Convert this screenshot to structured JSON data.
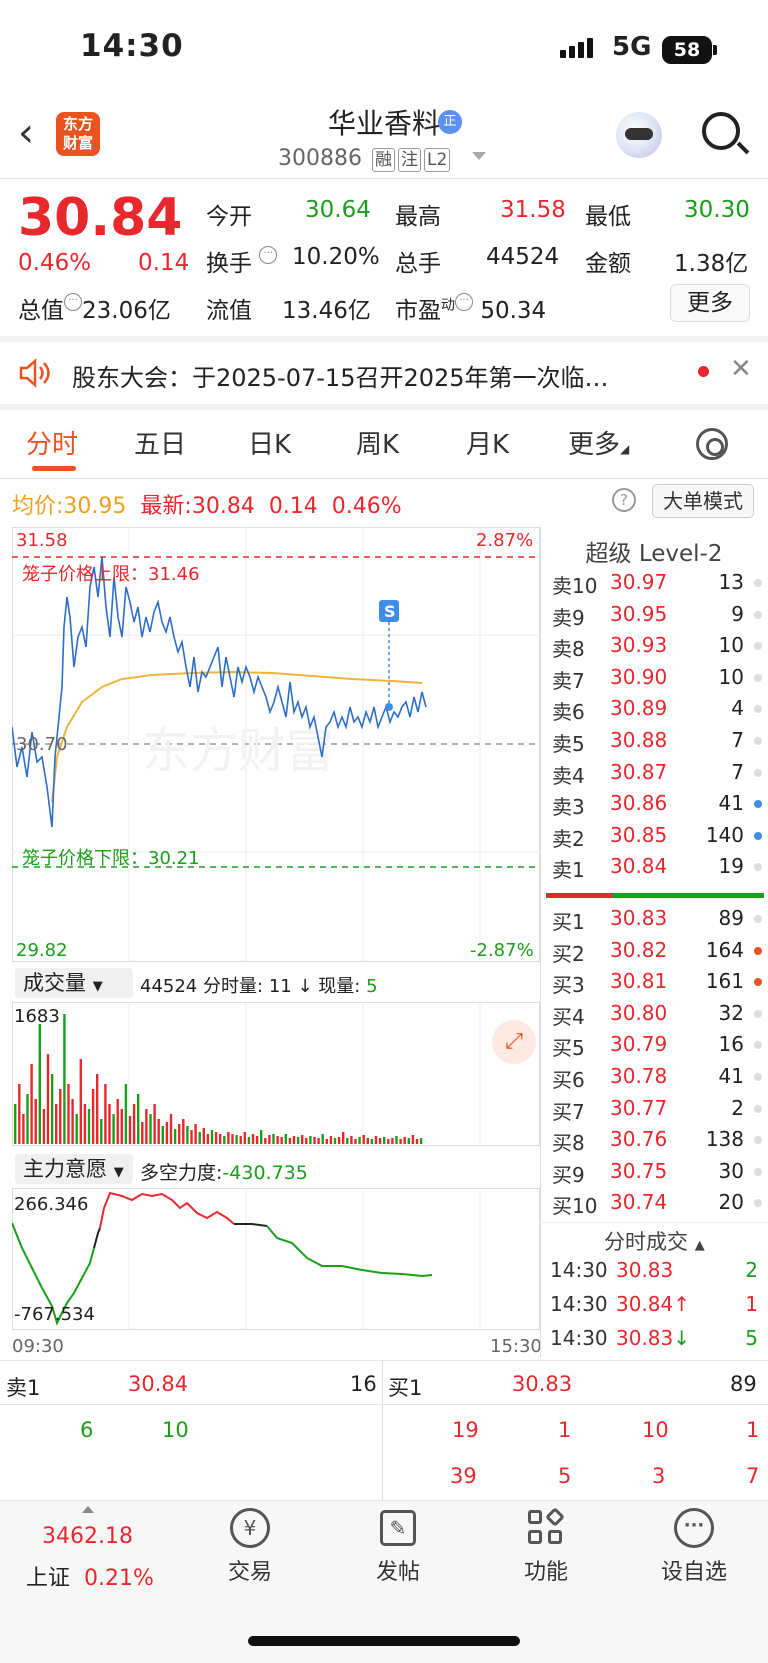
{
  "status_bar": {
    "time": "14:30",
    "network": "5G",
    "battery": "58"
  },
  "header": {
    "logo_text": "东方\n财富",
    "title": "华业香料",
    "title_badge": "正",
    "code": "300886",
    "tags": [
      "融",
      "注",
      "L2"
    ]
  },
  "quote": {
    "price": "30.84",
    "change_pct": "0.46%",
    "change": "0.14",
    "fields": [
      {
        "label": "今开",
        "value": "30.64"
      },
      {
        "label": "最高",
        "value": "31.58"
      },
      {
        "label": "最低",
        "value": "30.30"
      },
      {
        "label": "换手",
        "value": "10.20%"
      },
      {
        "label": "总手",
        "value": "44524"
      },
      {
        "label": "金额",
        "value": "1.38亿"
      },
      {
        "label": "总值",
        "value": "23.06亿"
      },
      {
        "label": "流值",
        "value": "13.46亿"
      },
      {
        "label": "市盈",
        "sup": "动",
        "value": "50.34"
      }
    ],
    "more_label": "更多"
  },
  "notice": {
    "text": "股东大会：于2025-07-15召开2025年第一次临…"
  },
  "tabs": [
    {
      "label": "分时",
      "active": true
    },
    {
      "label": "五日"
    },
    {
      "label": "日K"
    },
    {
      "label": "周K"
    },
    {
      "label": "月K"
    },
    {
      "label": "更多"
    }
  ],
  "summary": {
    "avg_label": "均价:",
    "avg_value": "30.95",
    "latest_label": "最新:",
    "latest_value": "30.84",
    "change": "0.14",
    "change_pct": "0.46%",
    "help": "?",
    "mode_label": "大单模式"
  },
  "price_chart": {
    "high_label": "31.58",
    "high_pct": "2.87%",
    "upper_limit_label": "笼子价格上限：31.46",
    "prev_close_label": "30.70",
    "lower_limit_label": "笼子价格下限：30.21",
    "low_label": "29.82",
    "low_pct": "-2.87%",
    "s_marker": "S",
    "watermark": "东方财富"
  },
  "volume_bar": {
    "selector": "成交量",
    "total": "44524",
    "min_label": "分时量:",
    "min_value": "11",
    "arrow": "↓",
    "cur_label": "现量:",
    "cur_value": "5",
    "max_label": "1683"
  },
  "force_bar": {
    "selector": "主力意愿",
    "label": "多空力度:",
    "value": "-430.735",
    "top_label": "266.346",
    "bottom_label": "-767.534",
    "start_time": "09:30",
    "end_time": "15:30"
  },
  "level2": {
    "title": "超级 Level-2",
    "asks": [
      {
        "k": "卖10",
        "p": "30.97",
        "v": "13",
        "dot": "gray"
      },
      {
        "k": "卖9",
        "p": "30.95",
        "v": "9",
        "dot": "gray"
      },
      {
        "k": "卖8",
        "p": "30.93",
        "v": "10",
        "dot": "gray"
      },
      {
        "k": "卖7",
        "p": "30.90",
        "v": "10",
        "dot": "gray"
      },
      {
        "k": "卖6",
        "p": "30.89",
        "v": "4",
        "dot": "gray"
      },
      {
        "k": "卖5",
        "p": "30.88",
        "v": "7",
        "dot": "gray"
      },
      {
        "k": "卖4",
        "p": "30.87",
        "v": "7",
        "dot": "gray"
      },
      {
        "k": "卖3",
        "p": "30.86",
        "v": "41",
        "dot": "blue"
      },
      {
        "k": "卖2",
        "p": "30.85",
        "v": "140",
        "dot": "blue"
      },
      {
        "k": "卖1",
        "p": "30.84",
        "v": "19",
        "dot": "gray"
      }
    ],
    "bids": [
      {
        "k": "买1",
        "p": "30.83",
        "v": "89",
        "dot": "gray"
      },
      {
        "k": "买2",
        "p": "30.82",
        "v": "164",
        "dot": "orange"
      },
      {
        "k": "买3",
        "p": "30.81",
        "v": "161",
        "dot": "orange"
      },
      {
        "k": "买4",
        "p": "30.80",
        "v": "32",
        "dot": "gray"
      },
      {
        "k": "买5",
        "p": "30.79",
        "v": "16",
        "dot": "gray"
      },
      {
        "k": "买6",
        "p": "30.78",
        "v": "41",
        "dot": "gray"
      },
      {
        "k": "买7",
        "p": "30.77",
        "v": "2",
        "dot": "gray"
      },
      {
        "k": "买8",
        "p": "30.76",
        "v": "138",
        "dot": "gray"
      },
      {
        "k": "买9",
        "p": "30.75",
        "v": "30",
        "dot": "gray"
      },
      {
        "k": "买10",
        "p": "30.74",
        "v": "20",
        "dot": "gray"
      }
    ],
    "ticks_title": "分时成交",
    "ticks": [
      {
        "t": "14:30",
        "p": "30.83",
        "arrow": "",
        "v": "2",
        "color": "green"
      },
      {
        "t": "14:30",
        "p": "30.84",
        "arrow": "↑",
        "v": "1",
        "color": "red"
      },
      {
        "t": "14:30",
        "p": "30.83",
        "arrow": "↓",
        "v": "5",
        "color": "green"
      }
    ]
  },
  "queue": {
    "ask_label": "卖1",
    "ask_price": "30.84",
    "ask_total": "16",
    "ask_orders": [
      "6",
      "10"
    ],
    "bid_label": "买1",
    "bid_price": "30.83",
    "bid_total": "89",
    "bid_orders_row1": [
      "19",
      "1",
      "10",
      "1"
    ],
    "bid_orders_row2": [
      "39",
      "5",
      "3",
      "7"
    ]
  },
  "bottom_nav": {
    "index_value": "3462.18",
    "index_name": "上证",
    "index_pct": "0.21%",
    "items": [
      {
        "label": "交易",
        "icon": "yen-cycle-icon"
      },
      {
        "label": "发帖",
        "icon": "edit-icon"
      },
      {
        "label": "功能",
        "icon": "grid-icon"
      },
      {
        "label": "设自选",
        "icon": "more-dots-icon"
      }
    ]
  },
  "colors": {
    "up": "#e8282d",
    "down": "#1a9f1a",
    "brand": "#e9531f",
    "price_line": "#2f6ec7",
    "avg_line": "#f0b43c"
  }
}
